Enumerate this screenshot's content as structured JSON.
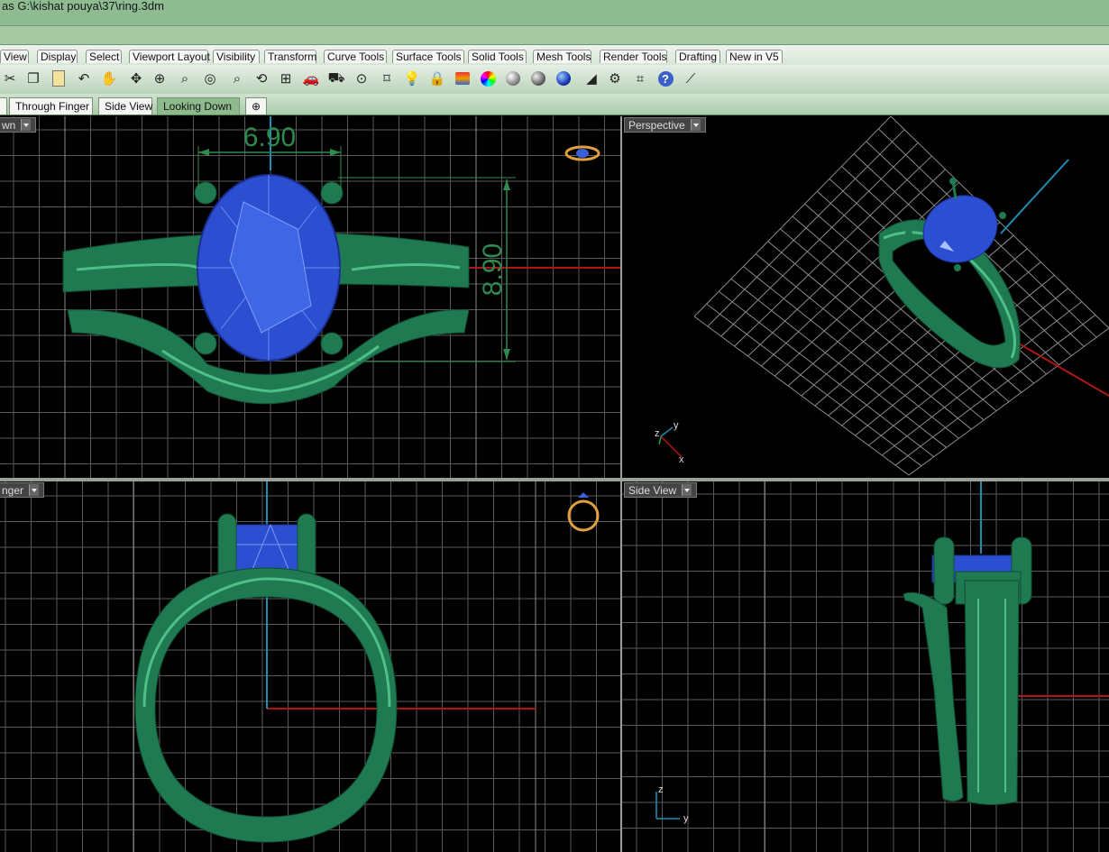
{
  "title_bar": {
    "text": "as G:\\kishat pouya\\37\\ring.3dm"
  },
  "menu_tabs": [
    "View",
    "Display",
    "Select",
    "Viewport Layout",
    "Visibility",
    "Transform",
    "Curve Tools",
    "Surface Tools",
    "Solid Tools",
    "Mesh Tools",
    "Render Tools",
    "Drafting",
    "New in V5"
  ],
  "toolbar_icons": [
    "cut-icon",
    "copy-icon",
    "paste-icon",
    "undo-icon",
    "pan-icon",
    "rotate-view-icon",
    "zoom-icon",
    "zoom-window-icon",
    "zoom-extents-icon",
    "zoom-selected-icon",
    "rotate-icon",
    "four-viewports-icon",
    "car-icon",
    "car-icon-2",
    "object-snap-icon",
    "sticky-icon",
    "light-icon",
    "lock-icon",
    "layer-icon",
    "color-wheel-icon",
    "sphere-gray-icon",
    "sphere-checked-icon",
    "sphere-blue-icon",
    "flag-icon",
    "gear-icon",
    "dimension-icon",
    "help-icon",
    "curve-icon"
  ],
  "viewport_tabs": [
    "Through Finger",
    "Side View",
    "Looking Down"
  ],
  "active_viewport_tab": "Looking Down",
  "viewports": {
    "top_left": {
      "label": "wn"
    },
    "top_right": {
      "label": "Perspective"
    },
    "bottom_left": {
      "label": "nger"
    },
    "bottom_right": {
      "label": "Side View"
    }
  },
  "dimensions": {
    "width": "6.90",
    "height": "8.90"
  },
  "axes": {
    "persp_z": "z",
    "persp_y": "y",
    "persp_x": "x",
    "side_z": "z",
    "side_y": "y"
  },
  "colors": {
    "ring_green": "#1f7a52",
    "gem_blue": "#2b4fd0",
    "grid": "#5a5a5a",
    "dimension": "#2e8a4e",
    "x_axis": "#b01515",
    "y_axis": "#1d8fb5"
  }
}
